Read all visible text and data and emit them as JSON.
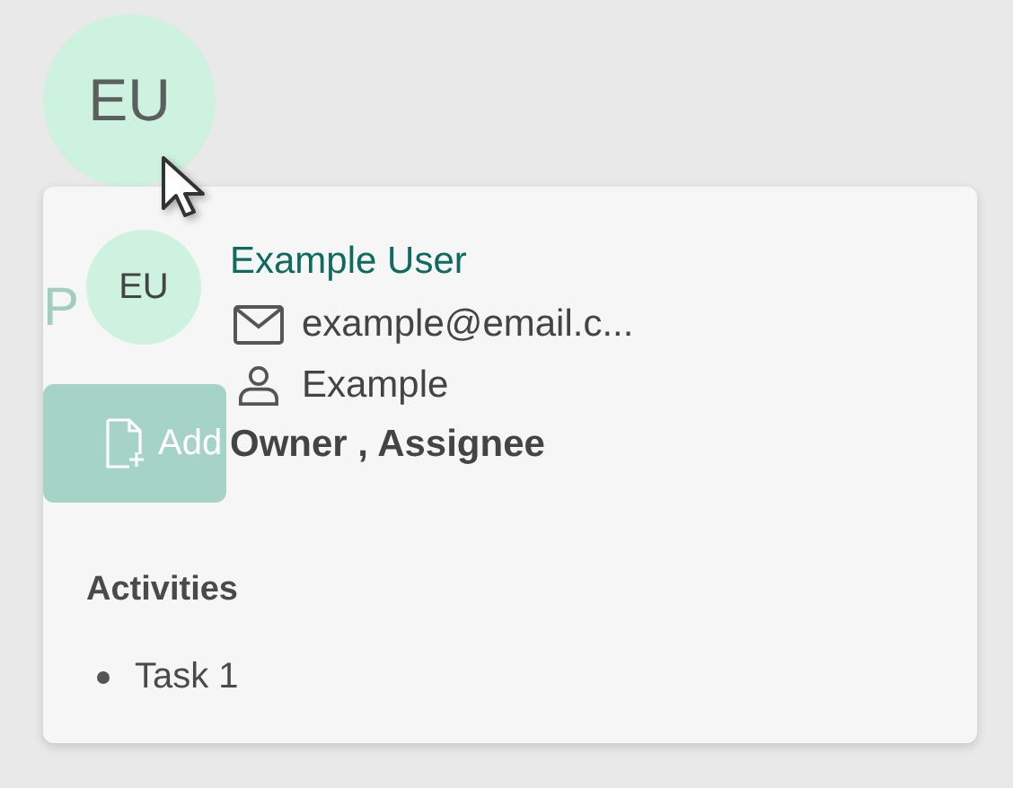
{
  "avatar": {
    "initials": "EU"
  },
  "background": {
    "heading": "P",
    "button": "Add"
  },
  "popover": {
    "avatar_initials": "EU",
    "name": "Example User",
    "email": "example@email.c...",
    "username": "Example",
    "roles": "Owner , Assignee",
    "activities_title": "Activities",
    "activities": [
      "Task 1"
    ]
  }
}
